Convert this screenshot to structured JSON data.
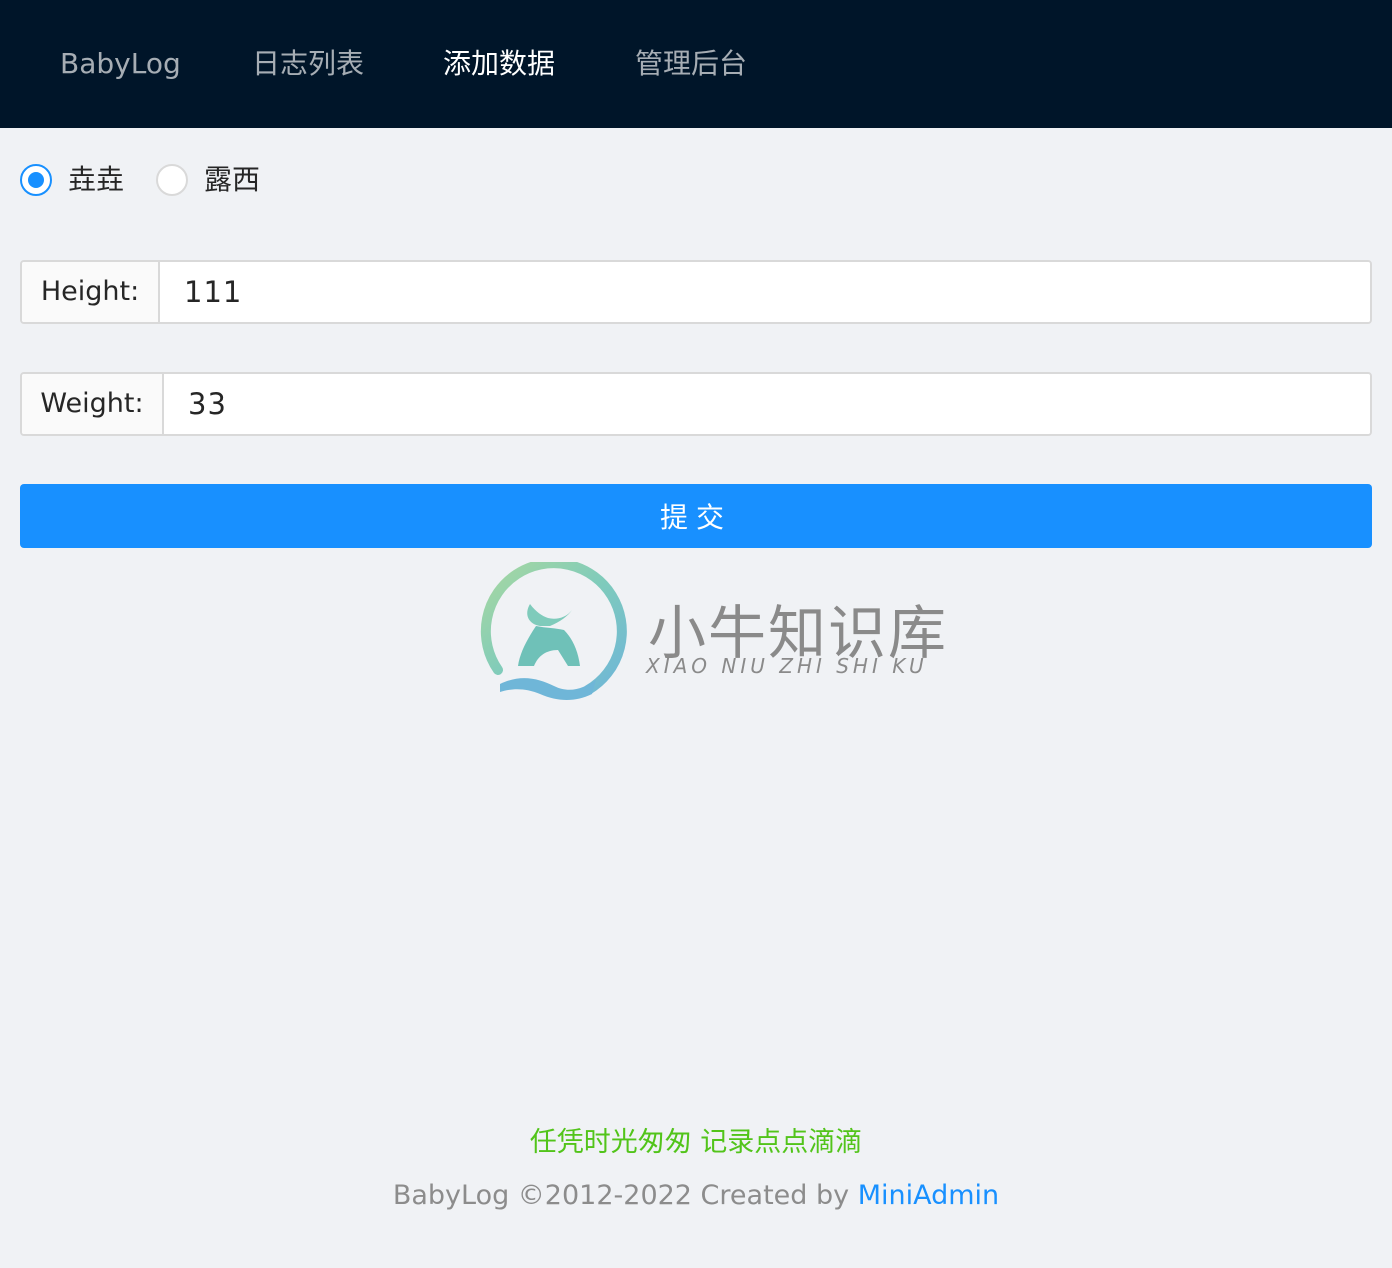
{
  "nav": {
    "items": [
      {
        "label": "BabyLog",
        "active": false
      },
      {
        "label": "日志列表",
        "active": false
      },
      {
        "label": "添加数据",
        "active": true
      },
      {
        "label": "管理后台",
        "active": false
      }
    ]
  },
  "baby_select": {
    "options": [
      "垚垚",
      "露西"
    ],
    "selected": "垚垚"
  },
  "form": {
    "height_label": "Height:",
    "height_value": "111",
    "weight_label": "Weight:",
    "weight_value": "33",
    "submit_label": "提交"
  },
  "watermark": {
    "title": "小牛知识库",
    "subtitle": "XIAO NIU ZHI SHI KU"
  },
  "footer": {
    "slogan": "任凭时光匆匆 记录点点滴滴",
    "copyright_text": "BabyLog ©2012-2022 Created by ",
    "link_text": "MiniAdmin"
  },
  "colors": {
    "nav_bg": "#001529",
    "primary": "#1890ff",
    "slogan": "#52c41a",
    "page_bg": "#f0f2f5"
  }
}
